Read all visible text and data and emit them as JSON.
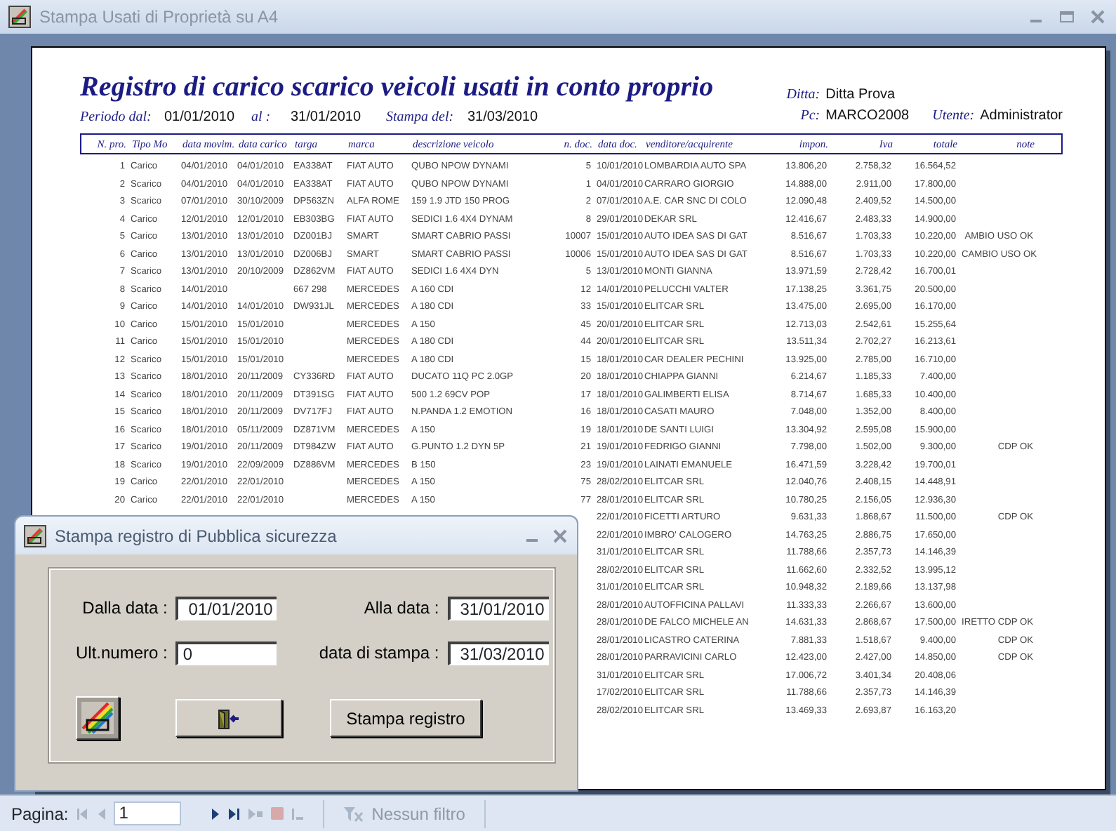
{
  "window": {
    "title": "Stampa Usati di Proprietà su A4"
  },
  "report": {
    "title": "Registro di carico scarico veicoli usati in conto proprio",
    "period_from_label": "Periodo dal:",
    "period_from": "01/01/2010",
    "period_to_label": "al :",
    "period_to": "31/01/2010",
    "print_date_label": "Stampa del:",
    "print_date": "31/03/2010",
    "company_label": "Ditta:",
    "company": "Ditta Prova",
    "pc_label": "Pc:",
    "pc": "MARCO2008",
    "user_label": "Utente:",
    "user": "Administrator",
    "columns": [
      "N. pro.",
      "Tipo Mo",
      "data movim.",
      "data carico",
      "targa",
      "marca",
      "descrizione veicolo",
      "n. doc.",
      "data doc.",
      "venditore/acquirente",
      "impon.",
      "Iva",
      "totale",
      "note"
    ],
    "rows": [
      {
        "cells": [
          "1",
          "Carico",
          "04/01/2010",
          "04/01/2010",
          "EA338AT",
          "FIAT AUTO",
          "QUBO NPOW DYNAMI",
          "5",
          "10/01/2010",
          "LOMBARDIA AUTO SPA",
          "13.806,20",
          "2.758,32",
          "16.564,52",
          ""
        ]
      },
      {
        "cells": [
          "2",
          "Scarico",
          "04/01/2010",
          "04/01/2010",
          "EA338AT",
          "FIAT AUTO",
          "QUBO NPOW DYNAMI",
          "1",
          "04/01/2010",
          "CARRARO GIORGIO",
          "14.888,00",
          "2.911,00",
          "17.800,00",
          ""
        ]
      },
      {
        "cells": [
          "3",
          "Scarico",
          "07/01/2010",
          "30/10/2009",
          "DP563ZN",
          "ALFA ROME",
          "159 1.9 JTD 150 PROG",
          "2",
          "07/01/2010",
          "A.E. CAR SNC DI COLO",
          "12.090,48",
          "2.409,52",
          "14.500,00",
          ""
        ]
      },
      {
        "cells": [
          "4",
          "Carico",
          "12/01/2010",
          "12/01/2010",
          "EB303BG",
          "FIAT AUTO",
          "SEDICI 1.6 4X4 DYNAM",
          "8",
          "29/01/2010",
          "DEKAR SRL",
          "12.416,67",
          "2.483,33",
          "14.900,00",
          ""
        ]
      },
      {
        "cells": [
          "5",
          "Carico",
          "13/01/2010",
          "13/01/2010",
          "DZ001BJ",
          "SMART",
          "SMART CABRIO PASSI",
          "10007",
          "15/01/2010",
          "AUTO IDEA SAS DI GAT",
          "8.516,67",
          "1.703,33",
          "10.220,00",
          "AMBIO USO OK"
        ]
      },
      {
        "cells": [
          "6",
          "Carico",
          "13/01/2010",
          "13/01/2010",
          "DZ006BJ",
          "SMART",
          "SMART CABRIO PASSI",
          "10006",
          "15/01/2010",
          "AUTO IDEA SAS DI GAT",
          "8.516,67",
          "1.703,33",
          "10.220,00",
          "CAMBIO USO OK"
        ]
      },
      {
        "cells": [
          "7",
          "Scarico",
          "13/01/2010",
          "20/10/2009",
          "DZ862VM",
          "FIAT AUTO",
          "SEDICI 1.6 4X4 DYN",
          "5",
          "13/01/2010",
          "MONTI GIANNA",
          "13.971,59",
          "2.728,42",
          "16.700,01",
          ""
        ]
      },
      {
        "cells": [
          "8",
          "Scarico",
          "14/01/2010",
          "",
          "667 298",
          "MERCEDES",
          "A 160 CDI",
          "12",
          "14/01/2010",
          "PELUCCHI VALTER",
          "17.138,25",
          "3.361,75",
          "20.500,00",
          ""
        ]
      },
      {
        "cells": [
          "9",
          "Carico",
          "14/01/2010",
          "14/01/2010",
          "DW931JL",
          "MERCEDES",
          "A 180 CDI",
          "33",
          "15/01/2010",
          "ELITCAR SRL",
          "13.475,00",
          "2.695,00",
          "16.170,00",
          ""
        ]
      },
      {
        "cells": [
          "10",
          "Carico",
          "15/01/2010",
          "15/01/2010",
          "",
          "MERCEDES",
          "A 150",
          "45",
          "20/01/2010",
          "ELITCAR SRL",
          "12.713,03",
          "2.542,61",
          "15.255,64",
          ""
        ]
      },
      {
        "cells": [
          "11",
          "Carico",
          "15/01/2010",
          "15/01/2010",
          "",
          "MERCEDES",
          "A 180 CDI",
          "44",
          "20/01/2010",
          "ELITCAR SRL",
          "13.511,34",
          "2.702,27",
          "16.213,61",
          ""
        ]
      },
      {
        "cells": [
          "12",
          "Scarico",
          "15/01/2010",
          "15/01/2010",
          "",
          "MERCEDES",
          "A 180 CDI",
          "15",
          "18/01/2010",
          "CAR DEALER PECHINI",
          "13.925,00",
          "2.785,00",
          "16.710,00",
          ""
        ]
      },
      {
        "cells": [
          "13",
          "Scarico",
          "18/01/2010",
          "20/11/2009",
          "CY336RD",
          "FIAT AUTO",
          "DUCATO 11Q PC 2.0GP",
          "20",
          "18/01/2010",
          "CHIAPPA GIANNI",
          "6.214,67",
          "1.185,33",
          "7.400,00",
          ""
        ]
      },
      {
        "cells": [
          "14",
          "Scarico",
          "18/01/2010",
          "20/11/2009",
          "DT391SG",
          "FIAT AUTO",
          "500 1.2 69CV POP",
          "17",
          "18/01/2010",
          "GALIMBERTI ELISA",
          "8.714,67",
          "1.685,33",
          "10.400,00",
          ""
        ]
      },
      {
        "cells": [
          "15",
          "Scarico",
          "18/01/2010",
          "20/11/2009",
          "DV717FJ",
          "FIAT AUTO",
          "N.PANDA 1.2 EMOTION",
          "16",
          "18/01/2010",
          "CASATI MAURO",
          "7.048,00",
          "1.352,00",
          "8.400,00",
          ""
        ]
      },
      {
        "cells": [
          "16",
          "Scarico",
          "18/01/2010",
          "05/11/2009",
          "DZ871VM",
          "MERCEDES",
          "A 150",
          "19",
          "18/01/2010",
          "DE SANTI LUIGI",
          "13.304,92",
          "2.595,08",
          "15.900,00",
          ""
        ]
      },
      {
        "cells": [
          "17",
          "Scarico",
          "19/01/2010",
          "20/11/2009",
          "DT984ZW",
          "FIAT AUTO",
          "G.PUNTO 1.2 DYN 5P",
          "21",
          "19/01/2010",
          "FEDRIGO GIANNI",
          "7.798,00",
          "1.502,00",
          "9.300,00",
          "CDP OK"
        ]
      },
      {
        "cells": [
          "18",
          "Scarico",
          "19/01/2010",
          "22/09/2009",
          "DZ886VM",
          "MERCEDES",
          "B 150",
          "23",
          "19/01/2010",
          "LAINATI EMANUELE",
          "16.471,59",
          "3.228,42",
          "19.700,01",
          ""
        ]
      },
      {
        "cells": [
          "19",
          "Carico",
          "22/01/2010",
          "22/01/2010",
          "",
          "MERCEDES",
          "A 150",
          "75",
          "28/02/2010",
          "ELITCAR SRL",
          "12.040,76",
          "2.408,15",
          "14.448,91",
          ""
        ]
      },
      {
        "cells": [
          "20",
          "Carico",
          "22/01/2010",
          "22/01/2010",
          "",
          "MERCEDES",
          "A 150",
          "77",
          "28/01/2010",
          "ELITCAR SRL",
          "10.780,25",
          "2.156,05",
          "12.936,30",
          ""
        ]
      },
      {
        "cells": [
          "22/01/2010",
          "FICETTI ARTURO",
          "9.631,33",
          "1.868,67",
          "11.500,00",
          "CDP OK"
        ]
      },
      {
        "cells": [
          "22/01/2010",
          "IMBRO' CALOGERO",
          "14.763,25",
          "2.886,75",
          "17.650,00",
          ""
        ]
      },
      {
        "cells": [
          "31/01/2010",
          "ELITCAR SRL",
          "11.788,66",
          "2.357,73",
          "14.146,39",
          ""
        ]
      },
      {
        "cells": [
          "28/02/2010",
          "ELITCAR SRL",
          "11.662,60",
          "2.332,52",
          "13.995,12",
          ""
        ]
      },
      {
        "cells": [
          "31/01/2010",
          "ELITCAR SRL",
          "10.948,32",
          "2.189,66",
          "13.137,98",
          ""
        ]
      },
      {
        "cells": [
          "28/01/2010",
          "AUTOFFICINA PALLAVI",
          "11.333,33",
          "2.266,67",
          "13.600,00",
          ""
        ]
      },
      {
        "cells": [
          "28/01/2010",
          "DE FALCO MICHELE AN",
          "14.631,33",
          "2.868,67",
          "17.500,00",
          "IRETTO CDP OK"
        ]
      },
      {
        "cells": [
          "28/01/2010",
          "LICASTRO CATERINA",
          "7.881,33",
          "1.518,67",
          "9.400,00",
          "CDP OK"
        ]
      },
      {
        "cells": [
          "28/01/2010",
          "PARRAVICINI CARLO",
          "12.423,00",
          "2.427,00",
          "14.850,00",
          "CDP OK"
        ]
      },
      {
        "cells": [
          "31/01/2010",
          "ELITCAR SRL",
          "17.006,72",
          "3.401,34",
          "20.408,06",
          ""
        ]
      },
      {
        "cells": [
          "17/02/2010",
          "ELITCAR SRL",
          "11.788,66",
          "2.357,73",
          "14.146,39",
          ""
        ]
      },
      {
        "cells": [
          "28/02/2010",
          "ELITCAR SRL",
          "13.469,33",
          "2.693,87",
          "16.163,20",
          ""
        ]
      }
    ]
  },
  "dialog": {
    "title": "Stampa registro di Pubblica sicurezza",
    "fields": [
      {
        "label": "Dalla data :",
        "value": "01/01/2010",
        "kind": "date"
      },
      {
        "label": "Alla data :",
        "value": "31/01/2010",
        "kind": "date"
      },
      {
        "label": "Ult.numero :",
        "value": "0",
        "kind": "number"
      },
      {
        "label": "data di stampa :",
        "value": "31/03/2010",
        "kind": "date"
      }
    ],
    "buttons": [
      {
        "kind": "logo"
      },
      {
        "kind": "exit"
      },
      {
        "kind": "text",
        "label": "Stampa registro"
      }
    ]
  },
  "status_bar": {
    "page_label": "Pagina:",
    "page": "1",
    "filter": "Nessun filtro"
  }
}
